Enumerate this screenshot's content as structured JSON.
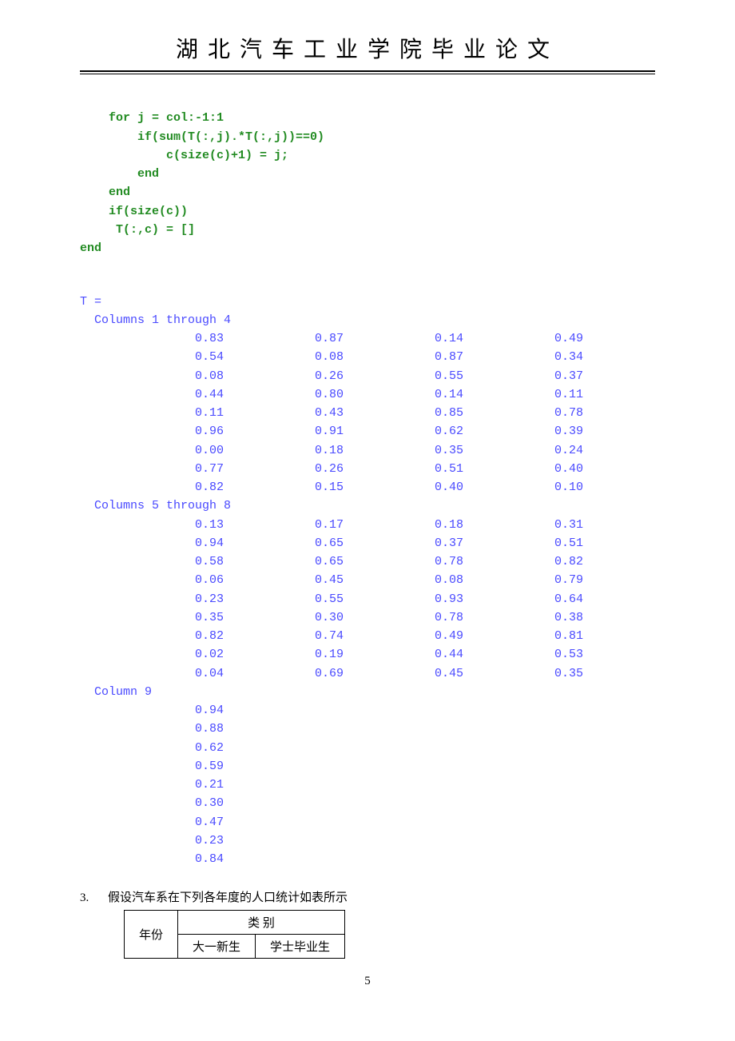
{
  "header": {
    "title": "湖北汽车工业学院毕业论文"
  },
  "code": {
    "line1": "    for j = col:-1:1",
    "line2": "        if(sum(T(:,j).*T(:,j))==0)",
    "line3": "            c(size(c)+1) = j;",
    "line4": "        end",
    "line5": "    end",
    "line6": "    if(size(c))",
    "line7": "     T(:,c) = []",
    "line8": "end"
  },
  "output": {
    "var": "T =",
    "sec1": "  Columns 1 through 4",
    "rows1": [
      [
        "0.83",
        "0.87",
        "0.14",
        "0.49"
      ],
      [
        "0.54",
        "0.08",
        "0.87",
        "0.34"
      ],
      [
        "0.08",
        "0.26",
        "0.55",
        "0.37"
      ],
      [
        "0.44",
        "0.80",
        "0.14",
        "0.11"
      ],
      [
        "0.11",
        "0.43",
        "0.85",
        "0.78"
      ],
      [
        "0.96",
        "0.91",
        "0.62",
        "0.39"
      ],
      [
        "0.00",
        "0.18",
        "0.35",
        "0.24"
      ],
      [
        "0.77",
        "0.26",
        "0.51",
        "0.40"
      ],
      [
        "0.82",
        "0.15",
        "0.40",
        "0.10"
      ]
    ],
    "sec2": "  Columns 5 through 8",
    "rows2": [
      [
        "0.13",
        "0.17",
        "0.18",
        "0.31"
      ],
      [
        "0.94",
        "0.65",
        "0.37",
        "0.51"
      ],
      [
        "0.58",
        "0.65",
        "0.78",
        "0.82"
      ],
      [
        "0.06",
        "0.45",
        "0.08",
        "0.79"
      ],
      [
        "0.23",
        "0.55",
        "0.93",
        "0.64"
      ],
      [
        "0.35",
        "0.30",
        "0.78",
        "0.38"
      ],
      [
        "0.82",
        "0.74",
        "0.49",
        "0.81"
      ],
      [
        "0.02",
        "0.19",
        "0.44",
        "0.53"
      ],
      [
        "0.04",
        "0.69",
        "0.45",
        "0.35"
      ]
    ],
    "sec3": "  Column 9",
    "rows3": [
      [
        "0.94"
      ],
      [
        "0.88"
      ],
      [
        "0.62"
      ],
      [
        "0.59"
      ],
      [
        "0.21"
      ],
      [
        "0.30"
      ],
      [
        "0.47"
      ],
      [
        "0.23"
      ],
      [
        "0.84"
      ]
    ]
  },
  "question": {
    "num": "3.",
    "text": "假设汽车系在下列各年度的人口统计如表所示"
  },
  "table": {
    "h_year": "年份",
    "h_cat": "类 别",
    "h_fresh": "大一新生",
    "h_grad": "学士毕业生"
  },
  "page_num": "5"
}
